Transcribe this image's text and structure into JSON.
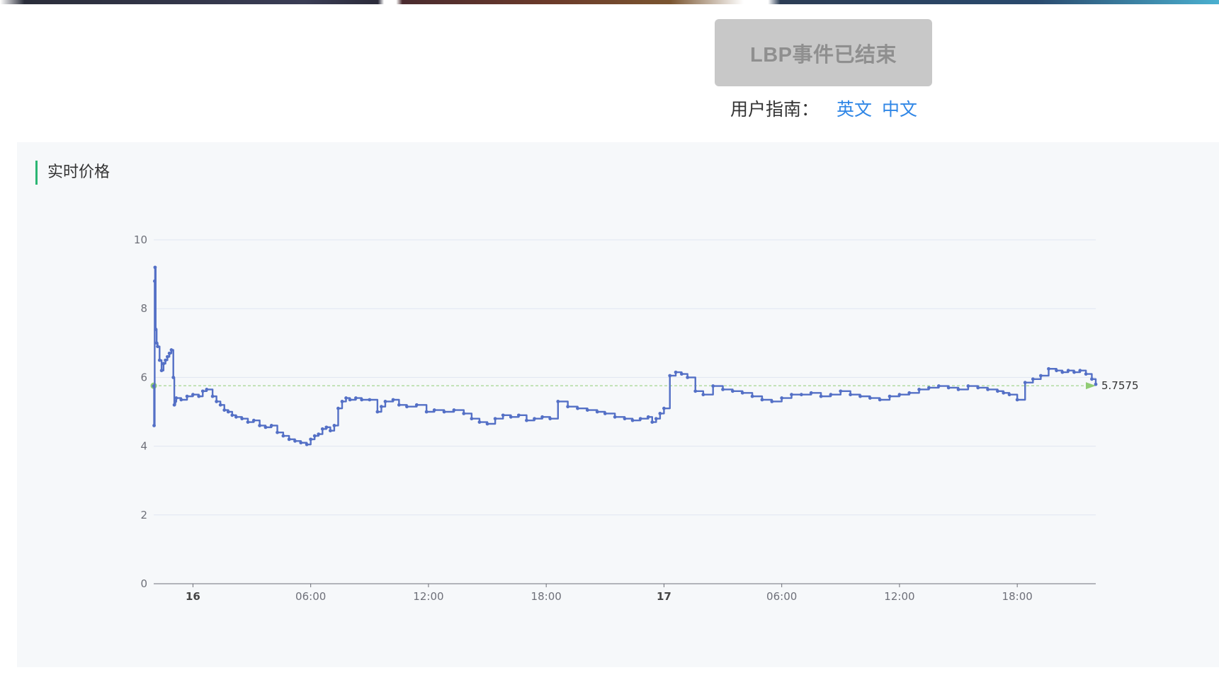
{
  "header": {
    "status_button": "LBP事件已结束",
    "guide_label": "用户指南：",
    "guide_links": [
      "英文",
      "中文"
    ]
  },
  "panel": {
    "title": "实时价格"
  },
  "colors": {
    "line": "#5470c6",
    "markline": "#91cc75",
    "accent_bar": "#2bb673",
    "link": "#2f86e6"
  },
  "chart_data": {
    "type": "line",
    "title": "",
    "xlabel": "",
    "ylabel": "",
    "ylim": [
      0,
      10
    ],
    "yticks": [
      0,
      2,
      4,
      6,
      8,
      10
    ],
    "xlim_hours": [
      -2,
      46
    ],
    "xticks": [
      {
        "label": "16",
        "hour": 0,
        "major": true
      },
      {
        "label": "06:00",
        "hour": 6,
        "major": false
      },
      {
        "label": "12:00",
        "hour": 12,
        "major": false
      },
      {
        "label": "18:00",
        "hour": 18,
        "major": false
      },
      {
        "label": "17",
        "hour": 24,
        "major": true
      },
      {
        "label": "06:00",
        "hour": 30,
        "major": false
      },
      {
        "label": "12:00",
        "hour": 36,
        "major": false
      },
      {
        "label": "18:00",
        "hour": 42,
        "major": false
      }
    ],
    "grid": true,
    "mark_line": {
      "value": 5.7575,
      "label": "5.7575"
    },
    "series": [
      {
        "x_hours": [
          -2.0,
          -1.98,
          -1.95,
          -1.93,
          -1.9,
          -1.85,
          -1.8,
          -1.7,
          -1.6,
          -1.5,
          -1.4,
          -1.3,
          -1.2,
          -1.1,
          -1.0,
          -0.95,
          -0.9,
          -0.85,
          -0.6,
          -0.3,
          0.0,
          0.3,
          0.5,
          0.7,
          1.0,
          1.2,
          1.4,
          1.6,
          1.8,
          2.0,
          2.2,
          2.5,
          2.8,
          3.1,
          3.4,
          3.7,
          4.0,
          4.3,
          4.6,
          4.9,
          5.2,
          5.5,
          5.8,
          6.0,
          6.2,
          6.4,
          6.6,
          6.8,
          7.0,
          7.2,
          7.4,
          7.6,
          7.8,
          8.0,
          8.3,
          8.6,
          9.0,
          9.4,
          9.6,
          9.8,
          10.2,
          10.5,
          10.9,
          11.4,
          11.9,
          12.3,
          12.8,
          13.3,
          13.8,
          14.2,
          14.6,
          15.0,
          15.4,
          15.8,
          16.2,
          16.6,
          17.0,
          17.4,
          17.8,
          18.2,
          18.6,
          19.1,
          19.6,
          20.1,
          20.6,
          21.0,
          21.5,
          22.0,
          22.4,
          22.8,
          23.2,
          23.4,
          23.6,
          23.8,
          24.0,
          24.3,
          24.6,
          24.9,
          25.2,
          25.6,
          26.0,
          26.5,
          27.0,
          27.5,
          28.0,
          28.5,
          29.0,
          29.5,
          30.0,
          30.5,
          31.0,
          31.5,
          32.0,
          32.5,
          33.0,
          33.5,
          34.0,
          34.5,
          35.0,
          35.5,
          36.0,
          36.5,
          37.0,
          37.5,
          38.0,
          38.5,
          39.0,
          39.5,
          40.0,
          40.5,
          41.0,
          41.3,
          41.6,
          42.0,
          42.4,
          42.8,
          43.2,
          43.6,
          44.0,
          44.3,
          44.6,
          44.9,
          45.2,
          45.5,
          45.8,
          46.0
        ],
        "values": [
          5.75,
          4.6,
          8.8,
          9.2,
          7.4,
          7.0,
          6.9,
          6.5,
          6.2,
          6.4,
          6.5,
          6.6,
          6.7,
          6.8,
          6.0,
          5.2,
          5.3,
          5.4,
          5.35,
          5.45,
          5.5,
          5.45,
          5.6,
          5.65,
          5.45,
          5.3,
          5.2,
          5.05,
          5.0,
          4.9,
          4.85,
          4.8,
          4.7,
          4.75,
          4.6,
          4.55,
          4.6,
          4.4,
          4.3,
          4.2,
          4.15,
          4.1,
          4.05,
          4.2,
          4.3,
          4.35,
          4.5,
          4.55,
          4.45,
          4.6,
          5.1,
          5.3,
          5.4,
          5.35,
          5.4,
          5.35,
          5.35,
          5.0,
          5.15,
          5.3,
          5.35,
          5.2,
          5.15,
          5.2,
          5.0,
          5.05,
          5.0,
          5.05,
          4.95,
          4.8,
          4.7,
          4.65,
          4.8,
          4.9,
          4.85,
          4.9,
          4.75,
          4.8,
          4.85,
          4.8,
          5.3,
          5.15,
          5.1,
          5.05,
          5.0,
          4.95,
          4.85,
          4.8,
          4.75,
          4.8,
          4.85,
          4.7,
          4.8,
          4.95,
          5.1,
          6.05,
          6.15,
          6.1,
          6.0,
          5.6,
          5.5,
          5.75,
          5.65,
          5.6,
          5.55,
          5.45,
          5.35,
          5.3,
          5.4,
          5.5,
          5.5,
          5.55,
          5.45,
          5.5,
          5.6,
          5.5,
          5.45,
          5.4,
          5.35,
          5.45,
          5.5,
          5.55,
          5.65,
          5.7,
          5.75,
          5.7,
          5.65,
          5.75,
          5.7,
          5.65,
          5.6,
          5.55,
          5.5,
          5.35,
          5.85,
          5.95,
          6.05,
          6.25,
          6.2,
          6.15,
          6.2,
          6.15,
          6.2,
          6.1,
          5.95,
          5.8,
          5.7,
          5.65,
          6.05,
          6.1
        ]
      }
    ]
  }
}
